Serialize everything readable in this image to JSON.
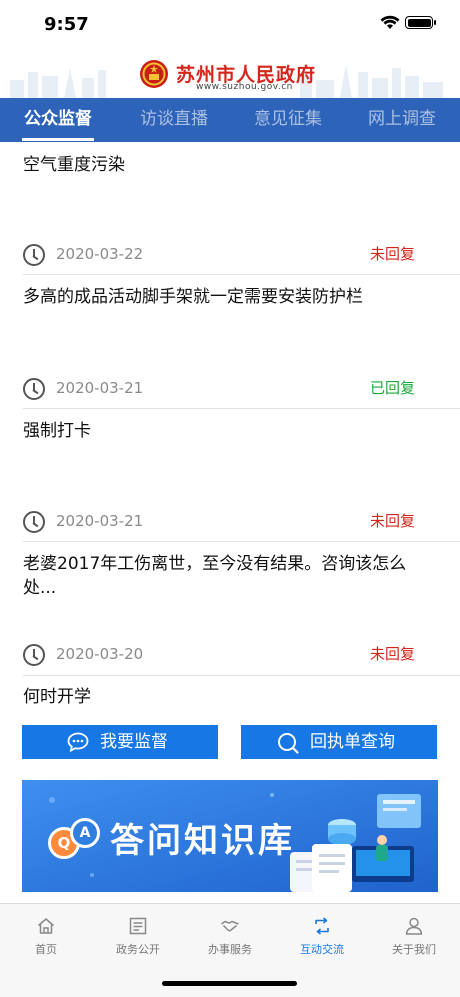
{
  "status_bar": {
    "time": "9:57"
  },
  "header": {
    "site_name": "苏州市人民政府",
    "site_url": "www.suzhou.gov.cn",
    "colors": {
      "brand_red": "#d6261c",
      "tab_blue": "#2d63b8"
    }
  },
  "tabs": [
    {
      "label": "公众监督",
      "active": true
    },
    {
      "label": "访谈直播",
      "active": false
    },
    {
      "label": "意见征集",
      "active": false
    },
    {
      "label": "网上调查",
      "active": false
    }
  ],
  "list": {
    "items": [
      {
        "title": "空气重度污染",
        "date": "2020-03-22",
        "status": "未回复"
      },
      {
        "title": "多高的成品活动脚手架就一定需要安装防护栏",
        "date": "2020-03-21",
        "status": "已回复"
      },
      {
        "title": "强制打卡",
        "date": "2020-03-21",
        "status": "未回复"
      },
      {
        "title": "老婆2017年工伤离世，至今没有结果。咨询该怎么处...",
        "date": "2020-03-20",
        "status": "未回复"
      },
      {
        "title": "何时开学"
      }
    ],
    "status_colors": {
      "未回复": "#d6261c",
      "已回复": "#1aab3a"
    }
  },
  "actions": {
    "supervise_label": "我要监督",
    "query_label": "回执单查询",
    "supervise_icon": "chat-bubble-icon",
    "query_icon": "search-icon"
  },
  "banner": {
    "text": "答问知识库",
    "badges": [
      "Q",
      "A"
    ]
  },
  "bottom_nav": [
    {
      "label": "首页",
      "icon": "home-icon",
      "active": false
    },
    {
      "label": "政务公开",
      "icon": "document-icon",
      "active": false
    },
    {
      "label": "办事服务",
      "icon": "handshake-icon",
      "active": false
    },
    {
      "label": "互动交流",
      "icon": "exchange-icon",
      "active": true
    },
    {
      "label": "关于我们",
      "icon": "person-icon",
      "active": false
    }
  ]
}
